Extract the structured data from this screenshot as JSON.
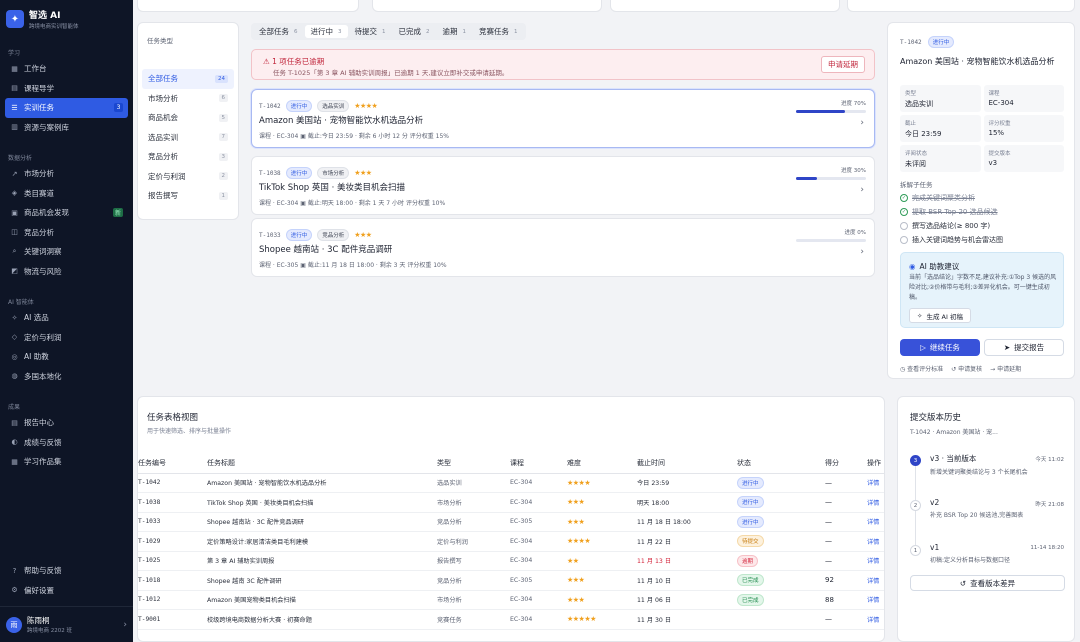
{
  "app": {
    "name": "智选 AI",
    "subtitle": "跨境电商实训智能体"
  },
  "sidebar": {
    "sections": [
      {
        "title": "学习",
        "items": [
          {
            "icon": "▦",
            "label": "工作台"
          },
          {
            "icon": "▤",
            "label": "课程导学"
          },
          {
            "icon": "☰",
            "label": "实训任务",
            "badge": "3",
            "active": true
          },
          {
            "icon": "▥",
            "label": "资源与案例库"
          }
        ]
      },
      {
        "title": "数据分析",
        "items": [
          {
            "icon": "↗",
            "label": "市场分析"
          },
          {
            "icon": "◈",
            "label": "类目赛道"
          },
          {
            "icon": "▣",
            "label": "商品机会发现",
            "badge": "新"
          },
          {
            "icon": "◫",
            "label": "竞品分析"
          },
          {
            "icon": "⌕",
            "label": "关键词洞察"
          },
          {
            "icon": "◩",
            "label": "物流与风险"
          }
        ]
      },
      {
        "title": "AI 智能体",
        "items": [
          {
            "icon": "✧",
            "label": "AI 选品"
          },
          {
            "icon": "◇",
            "label": "定价与利润"
          },
          {
            "icon": "◎",
            "label": "AI 助教"
          },
          {
            "icon": "◍",
            "label": "多国本地化"
          }
        ]
      },
      {
        "title": "成果",
        "items": [
          {
            "icon": "▤",
            "label": "报告中心"
          },
          {
            "icon": "◐",
            "label": "成绩与反馈"
          },
          {
            "icon": "▦",
            "label": "学习作品集"
          }
        ]
      }
    ],
    "bottom_items": [
      {
        "icon": "?",
        "label": "帮助与反馈"
      },
      {
        "icon": "⚙",
        "label": "偏好设置"
      }
    ],
    "user": {
      "avatar": "雨",
      "name": "陈雨桐",
      "sub": "跨境电商 2202 班"
    }
  },
  "categories": {
    "title": "任务类型",
    "items": [
      {
        "label": "全部任务",
        "count": "24",
        "active": true
      },
      {
        "label": "市场分析",
        "count": "6"
      },
      {
        "label": "商品机会",
        "count": "5"
      },
      {
        "label": "选品实训",
        "count": "7"
      },
      {
        "label": "竞品分析",
        "count": "3"
      },
      {
        "label": "定价与利润",
        "count": "2"
      },
      {
        "label": "报告撰写",
        "count": "1"
      }
    ]
  },
  "status_tabs": [
    {
      "label": "全部任务",
      "count": "6"
    },
    {
      "label": "进行中",
      "count": "3",
      "active": true
    },
    {
      "label": "待提交",
      "count": "1"
    },
    {
      "label": "已完成",
      "count": "2"
    },
    {
      "label": "逾期",
      "count": "1"
    },
    {
      "label": "竞赛任务",
      "count": "1"
    }
  ],
  "alert": {
    "title": "1 项任务已逾期",
    "desc": "任务 T-1025「第 3 章 AI 辅助实训周报」已逾期 1 天,建议立即补交或申请延期。",
    "button": "申请延期"
  },
  "tasks": [
    {
      "id": "T-1042",
      "status": "进行中",
      "type": "选品实训",
      "stars": "★★★★",
      "title": "Amazon 美国站 · 宠物智能饮水机选品分析",
      "course": "课程 · EC-304",
      "deadline": "截止:今日 23:59 · 剩余 6 小时 12 分",
      "weight": "评分权重 15%",
      "progress_label": "进度 70%",
      "progress": 0.7
    },
    {
      "id": "T-1038",
      "status": "进行中",
      "type": "市场分析",
      "stars": "★★★",
      "title": "TikTok Shop 英国 · 美妆类目机会扫描",
      "course": "课程 · EC-304",
      "deadline": "截止:明天 18:00 · 剩余 1 天 7 小时",
      "weight": "评分权重 10%",
      "progress_label": "进度 30%",
      "progress": 0.3
    },
    {
      "id": "T-1033",
      "status": "进行中",
      "type": "竞品分析",
      "stars": "★★★",
      "title": "Shopee 越南站 · 3C 配件竞品调研",
      "course": "课程 · EC-305",
      "deadline": "截止:11 月 18 日 18:00 · 剩余 3 天",
      "weight": "评分权重 10%",
      "progress_label": "进度 0%",
      "progress": 0
    }
  ],
  "detail": {
    "id": "T-1042",
    "status": "进行中",
    "title": "Amazon 美国站 · 宠物智能饮水机选品分析",
    "info": [
      {
        "k": "类型",
        "v": "选品实训"
      },
      {
        "k": "课程",
        "v": "EC-304"
      },
      {
        "k": "截止",
        "v": "今日 23:59"
      },
      {
        "k": "评分权重",
        "v": "15%"
      },
      {
        "k": "评阅状态",
        "v": "未评阅"
      },
      {
        "k": "提交版本",
        "v": "v3"
      }
    ],
    "subtasks_title": "拆解子任务",
    "subtasks": [
      {
        "label": "完成关键词聚类分析",
        "done": true
      },
      {
        "label": "提取 BSR Top 20 选品候选",
        "done": true
      },
      {
        "label": "撰写选品结论(≥ 800 字)",
        "done": false
      },
      {
        "label": "插入关键词趋势与机会雷达图",
        "done": false
      }
    ],
    "ai": {
      "title": "AI 助教建议",
      "desc": "当前「选品结论」字数不足,建议补充:①Top 3 候选的风险对比;②价格带与毛利;③差异化机会。可一键生成初稿。",
      "button": "生成 AI 初稿"
    },
    "primary_btn": "继续任务",
    "secondary_btn": "提交报告",
    "links": [
      "查看评分标准",
      "申请复核",
      "申请延期"
    ]
  },
  "table": {
    "title": "任务表格视图",
    "subtitle": "用于快速筛选、排序与批量操作",
    "columns": [
      "任务编号",
      "任务标题",
      "类型",
      "课程",
      "难度",
      "截止时间",
      "状态",
      "得分",
      "操作"
    ],
    "rows": [
      {
        "id": "T-1042",
        "title": "Amazon 美国站 · 宠物智能饮水机选品分析",
        "type": "选品实训",
        "course": "EC-304",
        "stars": "★★★★",
        "deadline": "今日 23:59",
        "status": "进行中",
        "tone": "blue",
        "score": "—",
        "action": "详情"
      },
      {
        "id": "T-1038",
        "title": "TikTok Shop 英国 · 美妆类目机会扫描",
        "type": "市场分析",
        "course": "EC-304",
        "stars": "★★★",
        "deadline": "明天 18:00",
        "status": "进行中",
        "tone": "blue",
        "score": "—",
        "action": "详情"
      },
      {
        "id": "T-1033",
        "title": "Shopee 越南站 · 3C 配件竞品调研",
        "type": "竞品分析",
        "course": "EC-305",
        "stars": "★★★",
        "deadline": "11 月 18 日 18:00",
        "status": "进行中",
        "tone": "blue",
        "score": "—",
        "action": "详情"
      },
      {
        "id": "T-1029",
        "title": "定价策略设计:家居清洁类目毛利建模",
        "type": "定价与利润",
        "course": "EC-304",
        "stars": "★★★★",
        "deadline": "11 月 22 日",
        "status": "待提交",
        "tone": "orange",
        "score": "—",
        "action": "详情"
      },
      {
        "id": "T-1025",
        "title": "第 3 章 AI 辅助实训周报",
        "type": "报告撰写",
        "course": "EC-304",
        "stars": "★★",
        "deadline": "11 月 13 日",
        "status": "逾期",
        "tone": "red",
        "score": "—",
        "action": "详情"
      },
      {
        "id": "T-1018",
        "title": "Shopee 越南 3C 配件调研",
        "type": "竞品分析",
        "course": "EC-305",
        "stars": "★★★",
        "deadline": "11 月 10 日",
        "status": "已完成",
        "tone": "green",
        "score": "92",
        "action": "详情"
      },
      {
        "id": "T-1012",
        "title": "Amazon 美国宠物类目机会扫描",
        "type": "市场分析",
        "course": "EC-304",
        "stars": "★★★",
        "deadline": "11 月 06 日",
        "status": "已完成",
        "tone": "green",
        "score": "88",
        "action": "详情"
      },
      {
        "id": "T-9001",
        "title": "校级跨境电商数据分析大赛 · 初赛命题",
        "type": "竞赛任务",
        "course": "EC-304",
        "stars": "★★★★★",
        "deadline": "11 月 30 日",
        "status": "",
        "tone": "grey",
        "score": "—",
        "action": "详情"
      }
    ]
  },
  "history": {
    "title": "提交版本历史",
    "subtitle": "T-1042 · Amazon 美国站 · 宠...",
    "items": [
      {
        "num": "3",
        "name": "v3 · 当前版本",
        "time": "今天 11:02",
        "desc": "新增关键词聚类结论与 3 个长尾机会",
        "current": true
      },
      {
        "num": "2",
        "name": "v2",
        "time": "昨天 21:08",
        "desc": "补充 BSR Top 20 候选池,完善图表"
      },
      {
        "num": "1",
        "name": "v1",
        "time": "11-14 18:20",
        "desc": "初稿:定义分析目标与数据口径"
      }
    ],
    "button": "查看版本差异"
  },
  "colors": {
    "accent": "#2f5be3",
    "sidebar": "#0e1526",
    "alert": "#c0243a",
    "star": "#f0a01e"
  }
}
